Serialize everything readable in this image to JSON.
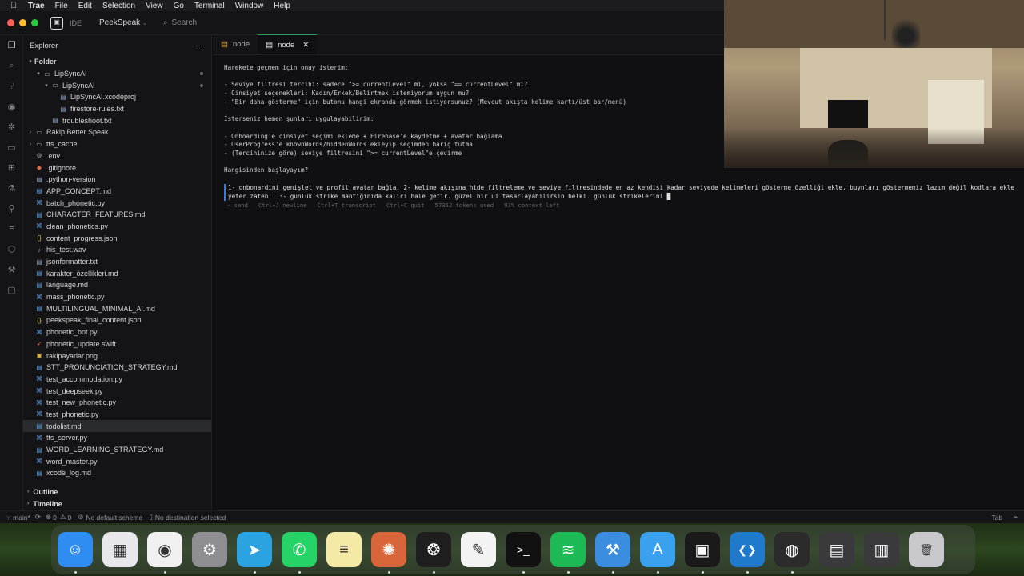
{
  "menubar": {
    "app": "Trae",
    "items": [
      "File",
      "Edit",
      "Selection",
      "View",
      "Go",
      "Terminal",
      "Window",
      "Help"
    ]
  },
  "titlebar": {
    "mode_label": "IDE",
    "project": "PeekSpeak",
    "search_placeholder": "Search"
  },
  "sidebar": {
    "title": "Explorer",
    "folder_label": "Folder",
    "rows": [
      {
        "name": "LipSyncAI",
        "type": "folder",
        "indent": 1,
        "open": true,
        "modified": true
      },
      {
        "name": "LipSyncAI",
        "type": "folder",
        "indent": 2,
        "open": true,
        "modified": true
      },
      {
        "name": "LipSyncAI.xcodeproj",
        "type": "file",
        "indent": 3,
        "modified": false
      },
      {
        "name": "firestore-rules.txt",
        "type": "file",
        "indent": 3,
        "modified": false
      },
      {
        "name": "troubleshoot.txt",
        "type": "file",
        "indent": 2,
        "modified": false
      },
      {
        "name": "Rakip Better Speak",
        "type": "folder",
        "indent": 0,
        "open": false,
        "modified": false
      },
      {
        "name": "tts_cache",
        "type": "folder",
        "indent": 0,
        "open": false,
        "modified": false
      },
      {
        "name": ".env",
        "type": "file",
        "indent": 0,
        "icon": "gear",
        "modified": false
      },
      {
        "name": ".gitignore",
        "type": "file",
        "indent": 0,
        "icon": "git",
        "modified": false
      },
      {
        "name": ".python-version",
        "type": "file",
        "indent": 0,
        "modified": false
      },
      {
        "name": "APP_CONCEPT.md",
        "type": "file",
        "indent": 0,
        "modified": false
      },
      {
        "name": "batch_phonetic.py",
        "type": "file",
        "indent": 0,
        "modified": false
      },
      {
        "name": "CHARACTER_FEATURES.md",
        "type": "file",
        "indent": 0,
        "modified": false
      },
      {
        "name": "clean_phonetics.py",
        "type": "file",
        "indent": 0,
        "modified": false
      },
      {
        "name": "content_progress.json",
        "type": "file",
        "indent": 0,
        "icon": "json",
        "modified": false
      },
      {
        "name": "his_test.wav",
        "type": "file",
        "indent": 0,
        "icon": "audio",
        "modified": false
      },
      {
        "name": "jsonformatter.txt",
        "type": "file",
        "indent": 0,
        "modified": false
      },
      {
        "name": "karakter_özellikleri.md",
        "type": "file",
        "indent": 0,
        "modified": false
      },
      {
        "name": "language.md",
        "type": "file",
        "indent": 0,
        "modified": false
      },
      {
        "name": "mass_phonetic.py",
        "type": "file",
        "indent": 0,
        "modified": false
      },
      {
        "name": "MULTILINGUAL_MINIMAL_AI.md",
        "type": "file",
        "indent": 0,
        "modified": false
      },
      {
        "name": "peekspeak_final_content.json",
        "type": "file",
        "indent": 0,
        "icon": "json",
        "modified": false
      },
      {
        "name": "phonetic_bot.py",
        "type": "file",
        "indent": 0,
        "modified": false
      },
      {
        "name": "phonetic_update.swift",
        "type": "file",
        "indent": 0,
        "icon": "swift",
        "modified": false
      },
      {
        "name": "rakipayarlar.png",
        "type": "file",
        "indent": 0,
        "icon": "image",
        "modified": false
      },
      {
        "name": "STT_PRONUNCIATION_STRATEGY.md",
        "type": "file",
        "indent": 0,
        "modified": false
      },
      {
        "name": "test_accommodation.py",
        "type": "file",
        "indent": 0,
        "modified": false
      },
      {
        "name": "test_deepseek.py",
        "type": "file",
        "indent": 0,
        "modified": false
      },
      {
        "name": "test_new_phonetic.py",
        "type": "file",
        "indent": 0,
        "modified": false
      },
      {
        "name": "test_phonetic.py",
        "type": "file",
        "indent": 0,
        "modified": false
      },
      {
        "name": "todolist.md",
        "type": "file",
        "indent": 0,
        "selected": true,
        "modified": false
      },
      {
        "name": "tts_server.py",
        "type": "file",
        "indent": 0,
        "modified": false
      },
      {
        "name": "WORD_LEARNING_STRATEGY.md",
        "type": "file",
        "indent": 0,
        "modified": false
      },
      {
        "name": "word_master.py",
        "type": "file",
        "indent": 0,
        "modified": false
      },
      {
        "name": "xcode_log.md",
        "type": "file",
        "indent": 0,
        "modified": false
      }
    ],
    "outline_label": "Outline",
    "timeline_label": "Timeline"
  },
  "tabs": [
    {
      "label": "node",
      "active": false
    },
    {
      "label": "node",
      "active": true
    }
  ],
  "terminal": {
    "lines": [
      "Harekete geçmem için onay isterim:",
      "",
      "- Seviye filtresi tercihi: sadece \">= currentLevel\" mi, yoksa \"== currentLevel\" mi?",
      "- Cinsiyet seçenekleri: Kadın/Erkek/Belirtmek istemiyorum uygun mu?",
      "- \"Bir daha gösterme\" için butonu hangi ekranda görmek istiyorsunuz? (Mevcut akışta kelime kartı/üst bar/menü)",
      "",
      "İsterseniz hemen şunları uygulayabilirim:",
      "",
      "- Onboarding'e cinsiyet seçimi ekleme + Firebase'e kaydetme + avatar bağlama",
      "- UserProgress'e knownWords/hiddenWords ekleyip seçimden hariç tutma",
      "- (Tercihinize göre) seviye filtresini \">= currentLevel\"e çevirme",
      "",
      "Hangisinden başlayayım?"
    ],
    "prompt": "1- onbonardini genişlet ve profil avatar bağla. 2- kelime akışına hide filtreleme ve seviye filtresindede en az kendisi kadar seviyede kelimeleri gösterme özelliği ekle. buynları göstermemiz lazım değil kodlara ekle yeter zaten.  3- günlük strike mantığınıda kalıcı hale getir. güzel bir ui tasarlayabilirsin belki. günlük strikelerini ",
    "hints": "⏎ send   Ctrl+J newline   Ctrl+T transcript   Ctrl+C quit   57352 tokens used   93% context left"
  },
  "statusbar": {
    "branch": "main*",
    "errors": "0",
    "warnings": "0",
    "scheme": "No default scheme",
    "destination": "No destination selected",
    "right": "Tab"
  },
  "dock": {
    "apps": [
      {
        "name": "Finder",
        "color": "#2f8cf0",
        "glyph": "☺",
        "running": true
      },
      {
        "name": "Launchpad",
        "color": "#e8e8ec",
        "glyph": "▦",
        "running": false
      },
      {
        "name": "Chrome",
        "color": "#f0f0f0",
        "glyph": "◉",
        "running": true
      },
      {
        "name": "System Settings",
        "color": "#8e8e93",
        "glyph": "⚙",
        "running": false
      },
      {
        "name": "Telegram",
        "color": "#2aa3e0",
        "glyph": "➤",
        "running": true
      },
      {
        "name": "WhatsApp",
        "color": "#25d366",
        "glyph": "✆",
        "running": true
      },
      {
        "name": "Notes",
        "color": "#f5e9a6",
        "glyph": "≡",
        "running": false
      },
      {
        "name": "Claude",
        "color": "#d9653b",
        "glyph": "✺",
        "running": true
      },
      {
        "name": "ChatGPT",
        "color": "#1e1e1e",
        "glyph": "❂",
        "running": true
      },
      {
        "name": "TextEdit",
        "color": "#f3f3f3",
        "glyph": "✎",
        "running": false
      },
      {
        "name": "Terminal",
        "color": "#111111",
        "glyph": ">_",
        "running": true
      },
      {
        "name": "Spotify",
        "color": "#1db954",
        "glyph": "≋",
        "running": true
      },
      {
        "name": "Xcode",
        "color": "#3b8de0",
        "glyph": "⚒",
        "running": true
      },
      {
        "name": "Instruments",
        "color": "#3aa0f0",
        "glyph": "A",
        "running": true
      },
      {
        "name": "Trae",
        "color": "#1a1a1a",
        "glyph": "▣",
        "running": true
      },
      {
        "name": "VS Code",
        "color": "#1f7acc",
        "glyph": "❮❯",
        "running": true
      },
      {
        "name": "OBS",
        "color": "#2b2b2b",
        "glyph": "◍",
        "running": true
      },
      {
        "name": "Screenshot",
        "color": "#3a3a3c",
        "glyph": "▤",
        "running": false
      },
      {
        "name": "Preview",
        "color": "#3a3a3c",
        "glyph": "▥",
        "running": false
      },
      {
        "name": "Trash",
        "color": "#c7c7cc",
        "glyph": "🗑",
        "running": false
      }
    ]
  }
}
